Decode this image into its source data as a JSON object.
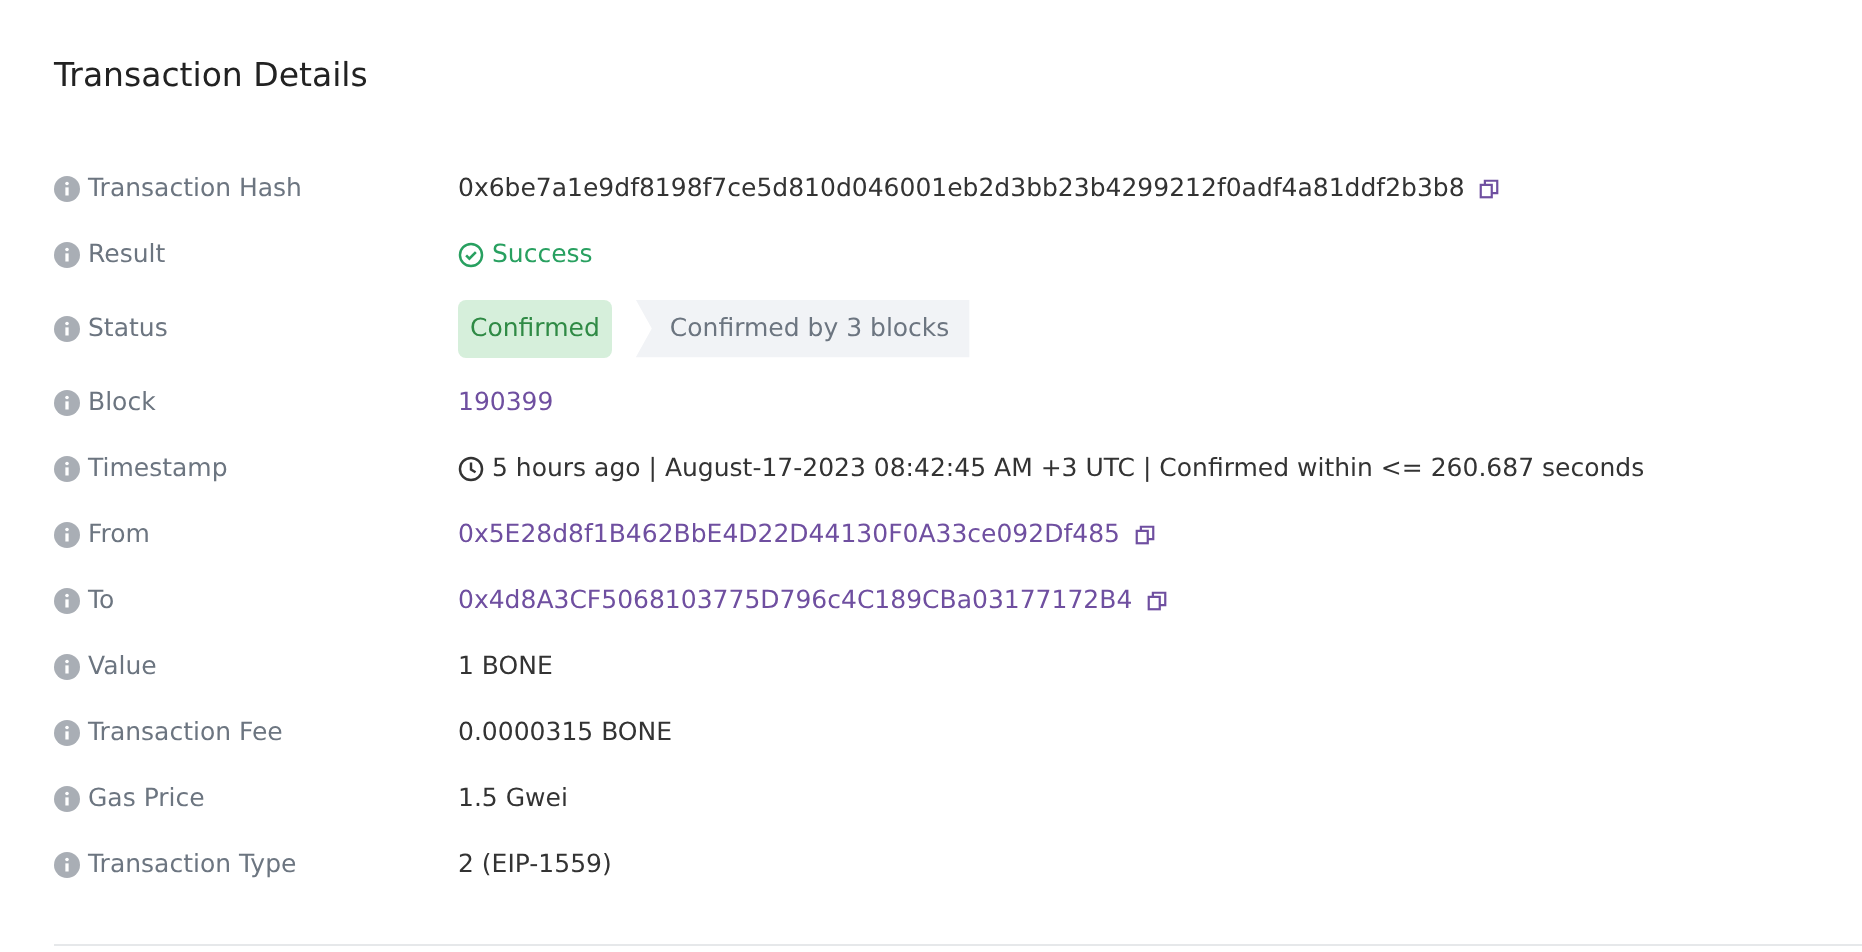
{
  "title": "Transaction Details",
  "rows": [
    {
      "label": "Transaction Hash",
      "kind": "text",
      "value": "0x6be7a1e9df8198f7ce5d810d046001eb2d3bb23b4299212f0adf4a81ddf2b3b8",
      "copyable": true
    },
    {
      "label": "Result",
      "kind": "success",
      "value": "Success"
    },
    {
      "label": "Status",
      "kind": "status",
      "value": "Confirmed",
      "note": "Confirmed by 3 blocks"
    },
    {
      "label": "Block",
      "kind": "link",
      "value": "190399"
    },
    {
      "label": "Timestamp",
      "kind": "time",
      "value": "5 hours ago | August-17-2023 08:42:45 AM +3 UTC | Confirmed within <= 260.687 seconds"
    },
    {
      "label": "From",
      "kind": "link",
      "value": "0x5E28d8f1B462BbE4D22D44130F0A33ce092Df485",
      "copyable": true
    },
    {
      "label": "To",
      "kind": "link",
      "value": "0x4d8A3CF5068103775D796c4C189CBa03177172B4",
      "copyable": true
    },
    {
      "label": "Value",
      "kind": "text",
      "value": "1 BONE"
    },
    {
      "label": "Transaction Fee",
      "kind": "text",
      "value": "0.0000315 BONE"
    },
    {
      "label": "Gas Price",
      "kind": "text",
      "value": "1.5 Gwei"
    },
    {
      "label": "Transaction Type",
      "kind": "text",
      "value": "2 (EIP-1559)"
    }
  ]
}
